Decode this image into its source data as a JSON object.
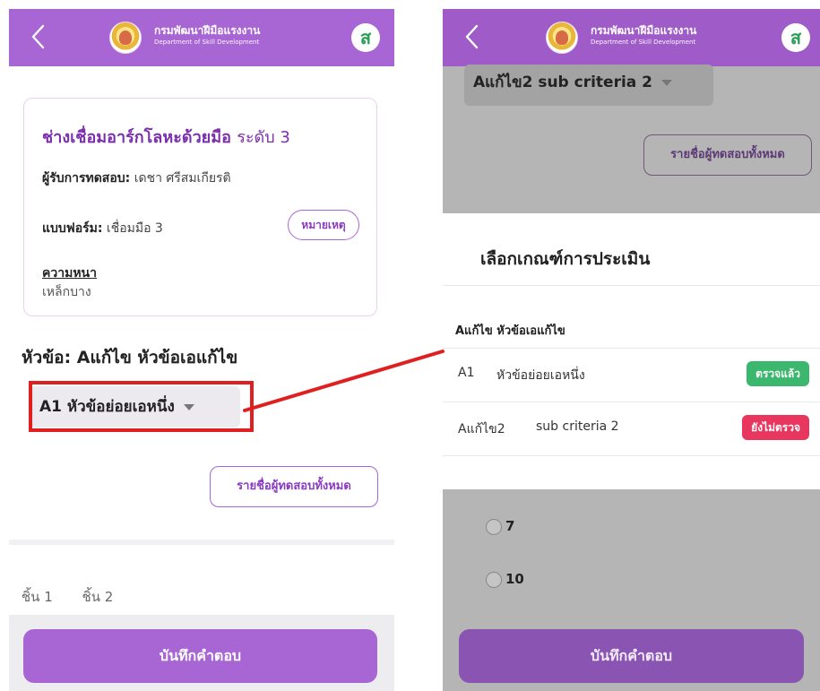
{
  "header": {
    "org_th": "กรมพัฒนาฝีมือแรงงาน",
    "org_en": "Department of Skill Development",
    "avatar_letter": "ส",
    "back_icon": "chevron-left-icon",
    "color": "#a865d4"
  },
  "left": {
    "card": {
      "title": "ช่างเชื่อมอาร์กโลหะด้วยมือ",
      "level": "ระดับ 3",
      "examinee_label": "ผู้รับการทดสอบ:",
      "examinee_value": "เดชา ศรีสมเกียรติ",
      "form_label": "แบบฟอร์ม:",
      "form_value": "เชื่อมมือ 3",
      "note_button": "หมายเหตุ",
      "thickness_label": "ความหนา",
      "thickness_value": "เหล็กบาง"
    },
    "topic": "หัวข้อ: Aแก้ไข หัวข้อเอแก้ไข",
    "sub_dropdown": "A1 หัวข้อย่อยเอหนึ่ง",
    "all_examinees_button": "รายชื่อผู้ทดสอบทั้งหมด",
    "pieces": [
      "ชิ้น 1",
      "ชิ้น 2"
    ],
    "save_button": "บันทึกคำตอบ"
  },
  "right": {
    "sub_dropdown": "Aแก้ไข2 sub criteria 2",
    "all_examinees_button": "รายชื่อผู้ทดสอบทั้งหมด",
    "sheet": {
      "title": "เลือกเกณฑ์การประเมิน",
      "group": "Aแก้ไข หัวข้อเอแก้ไข",
      "items": [
        {
          "code": "A1",
          "name": "หัวข้อย่อยเอหนึ่ง",
          "status": "ตรวจแล้ว",
          "status_color": "#3bb86e"
        },
        {
          "code": "Aแก้ไข2",
          "name": "sub criteria 2",
          "status": "ยังไม่ตรวจ",
          "status_color": "#e8365f"
        }
      ]
    },
    "radio_options": [
      "7",
      "10"
    ],
    "save_button": "บันทึกคำตอบ"
  },
  "annotation_color": "#e02020"
}
